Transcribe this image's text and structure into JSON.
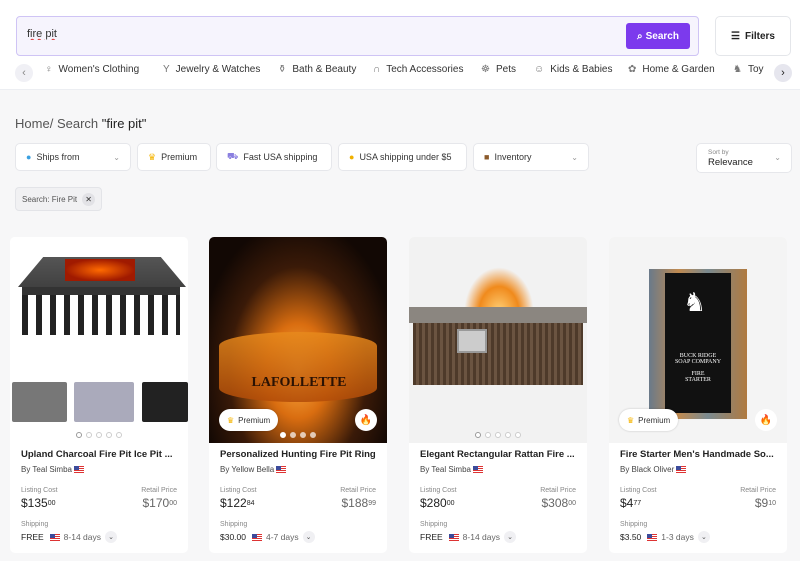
{
  "search": {
    "value": "fire pit",
    "button": "Search"
  },
  "filters_label": "Filters",
  "categories": [
    {
      "label": "Women's Clothing",
      "icon": "dress-icon"
    },
    {
      "label": "Jewelry & Watches",
      "icon": "necklace-icon"
    },
    {
      "label": "Bath & Beauty",
      "icon": "bottle-icon"
    },
    {
      "label": "Tech Accessories",
      "icon": "headphones-icon"
    },
    {
      "label": "Pets",
      "icon": "dog-icon"
    },
    {
      "label": "Kids & Babies",
      "icon": "bear-icon"
    },
    {
      "label": "Home & Garden",
      "icon": "plant-icon"
    },
    {
      "label": "Toy",
      "icon": "toy-icon"
    }
  ],
  "breadcrumb": {
    "home": "Home",
    "sep": "/",
    "search": "Search",
    "query": "\"fire pit\""
  },
  "chips": [
    "Ships from",
    "Premium",
    "Fast USA shipping",
    "USA shipping under $5",
    "Inventory"
  ],
  "sort": {
    "label": "Sort by",
    "value": "Relevance"
  },
  "active_tag": "Search: Fire Pit",
  "labels": {
    "listing": "Listing Cost",
    "retail": "Retail Price",
    "shipping": "Shipping",
    "premium": "Premium"
  },
  "products": [
    {
      "title": "Upland Charcoal Fire Pit Ice Pit ...",
      "seller": "By Teal Simba",
      "listing": "$135",
      "listing_c": "00",
      "retail": "$170",
      "retail_c": "00",
      "ship": "FREE",
      "days": "8-14 days",
      "premium": false
    },
    {
      "title": "Personalized Hunting Fire Pit Ring",
      "seller": "By Yellow Bella",
      "listing": "$122",
      "listing_c": "84",
      "retail": "$188",
      "retail_c": "99",
      "ship": "$30.00",
      "days": "4-7 days",
      "premium": true
    },
    {
      "title": "Elegant Rectangular Rattan Fire ...",
      "seller": "By Teal Simba",
      "listing": "$280",
      "listing_c": "00",
      "retail": "$308",
      "retail_c": "00",
      "ship": "FREE",
      "days": "8-14 days",
      "premium": false
    },
    {
      "title": "Fire Starter Men's Handmade So...",
      "seller": "By Black Oliver",
      "listing": "$4",
      "listing_c": "77",
      "retail": "$9",
      "retail_c": "10",
      "ship": "$3.50",
      "days": "1-3 days",
      "premium": true
    }
  ],
  "colors": {
    "accent": "#7c3aed"
  }
}
